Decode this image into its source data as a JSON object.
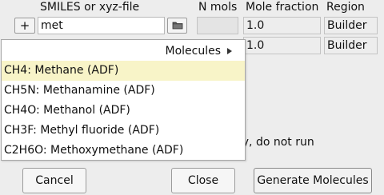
{
  "columns": {
    "smiles": "SMILES or xyz-file",
    "n_mols": "N mols",
    "mole_fraction": "Mole fraction",
    "region": "Region"
  },
  "rows": [
    {
      "add_label": "+",
      "smiles_value": "met",
      "folder_icon": "folder-icon",
      "n_mols": "",
      "mole_fraction": "1.0",
      "region": "Builder"
    },
    {
      "mole_fraction": "1.0",
      "region": "Builder"
    }
  ],
  "dropdown": {
    "category": "Molecules",
    "items": [
      "CH4: Methane (ADF)",
      "CH5N: Methanamine (ADF)",
      "CH4O: Methanol (ADF)",
      "CH3F: Methyl fluoride (ADF)",
      "C2H6O: Methoxymethane (ADF)"
    ],
    "highlight_color": "#f8f4c8"
  },
  "option_text": "nly, do not run",
  "buttons": {
    "cancel": "Cancel",
    "close": "Close",
    "generate": "Generate Molecules"
  }
}
